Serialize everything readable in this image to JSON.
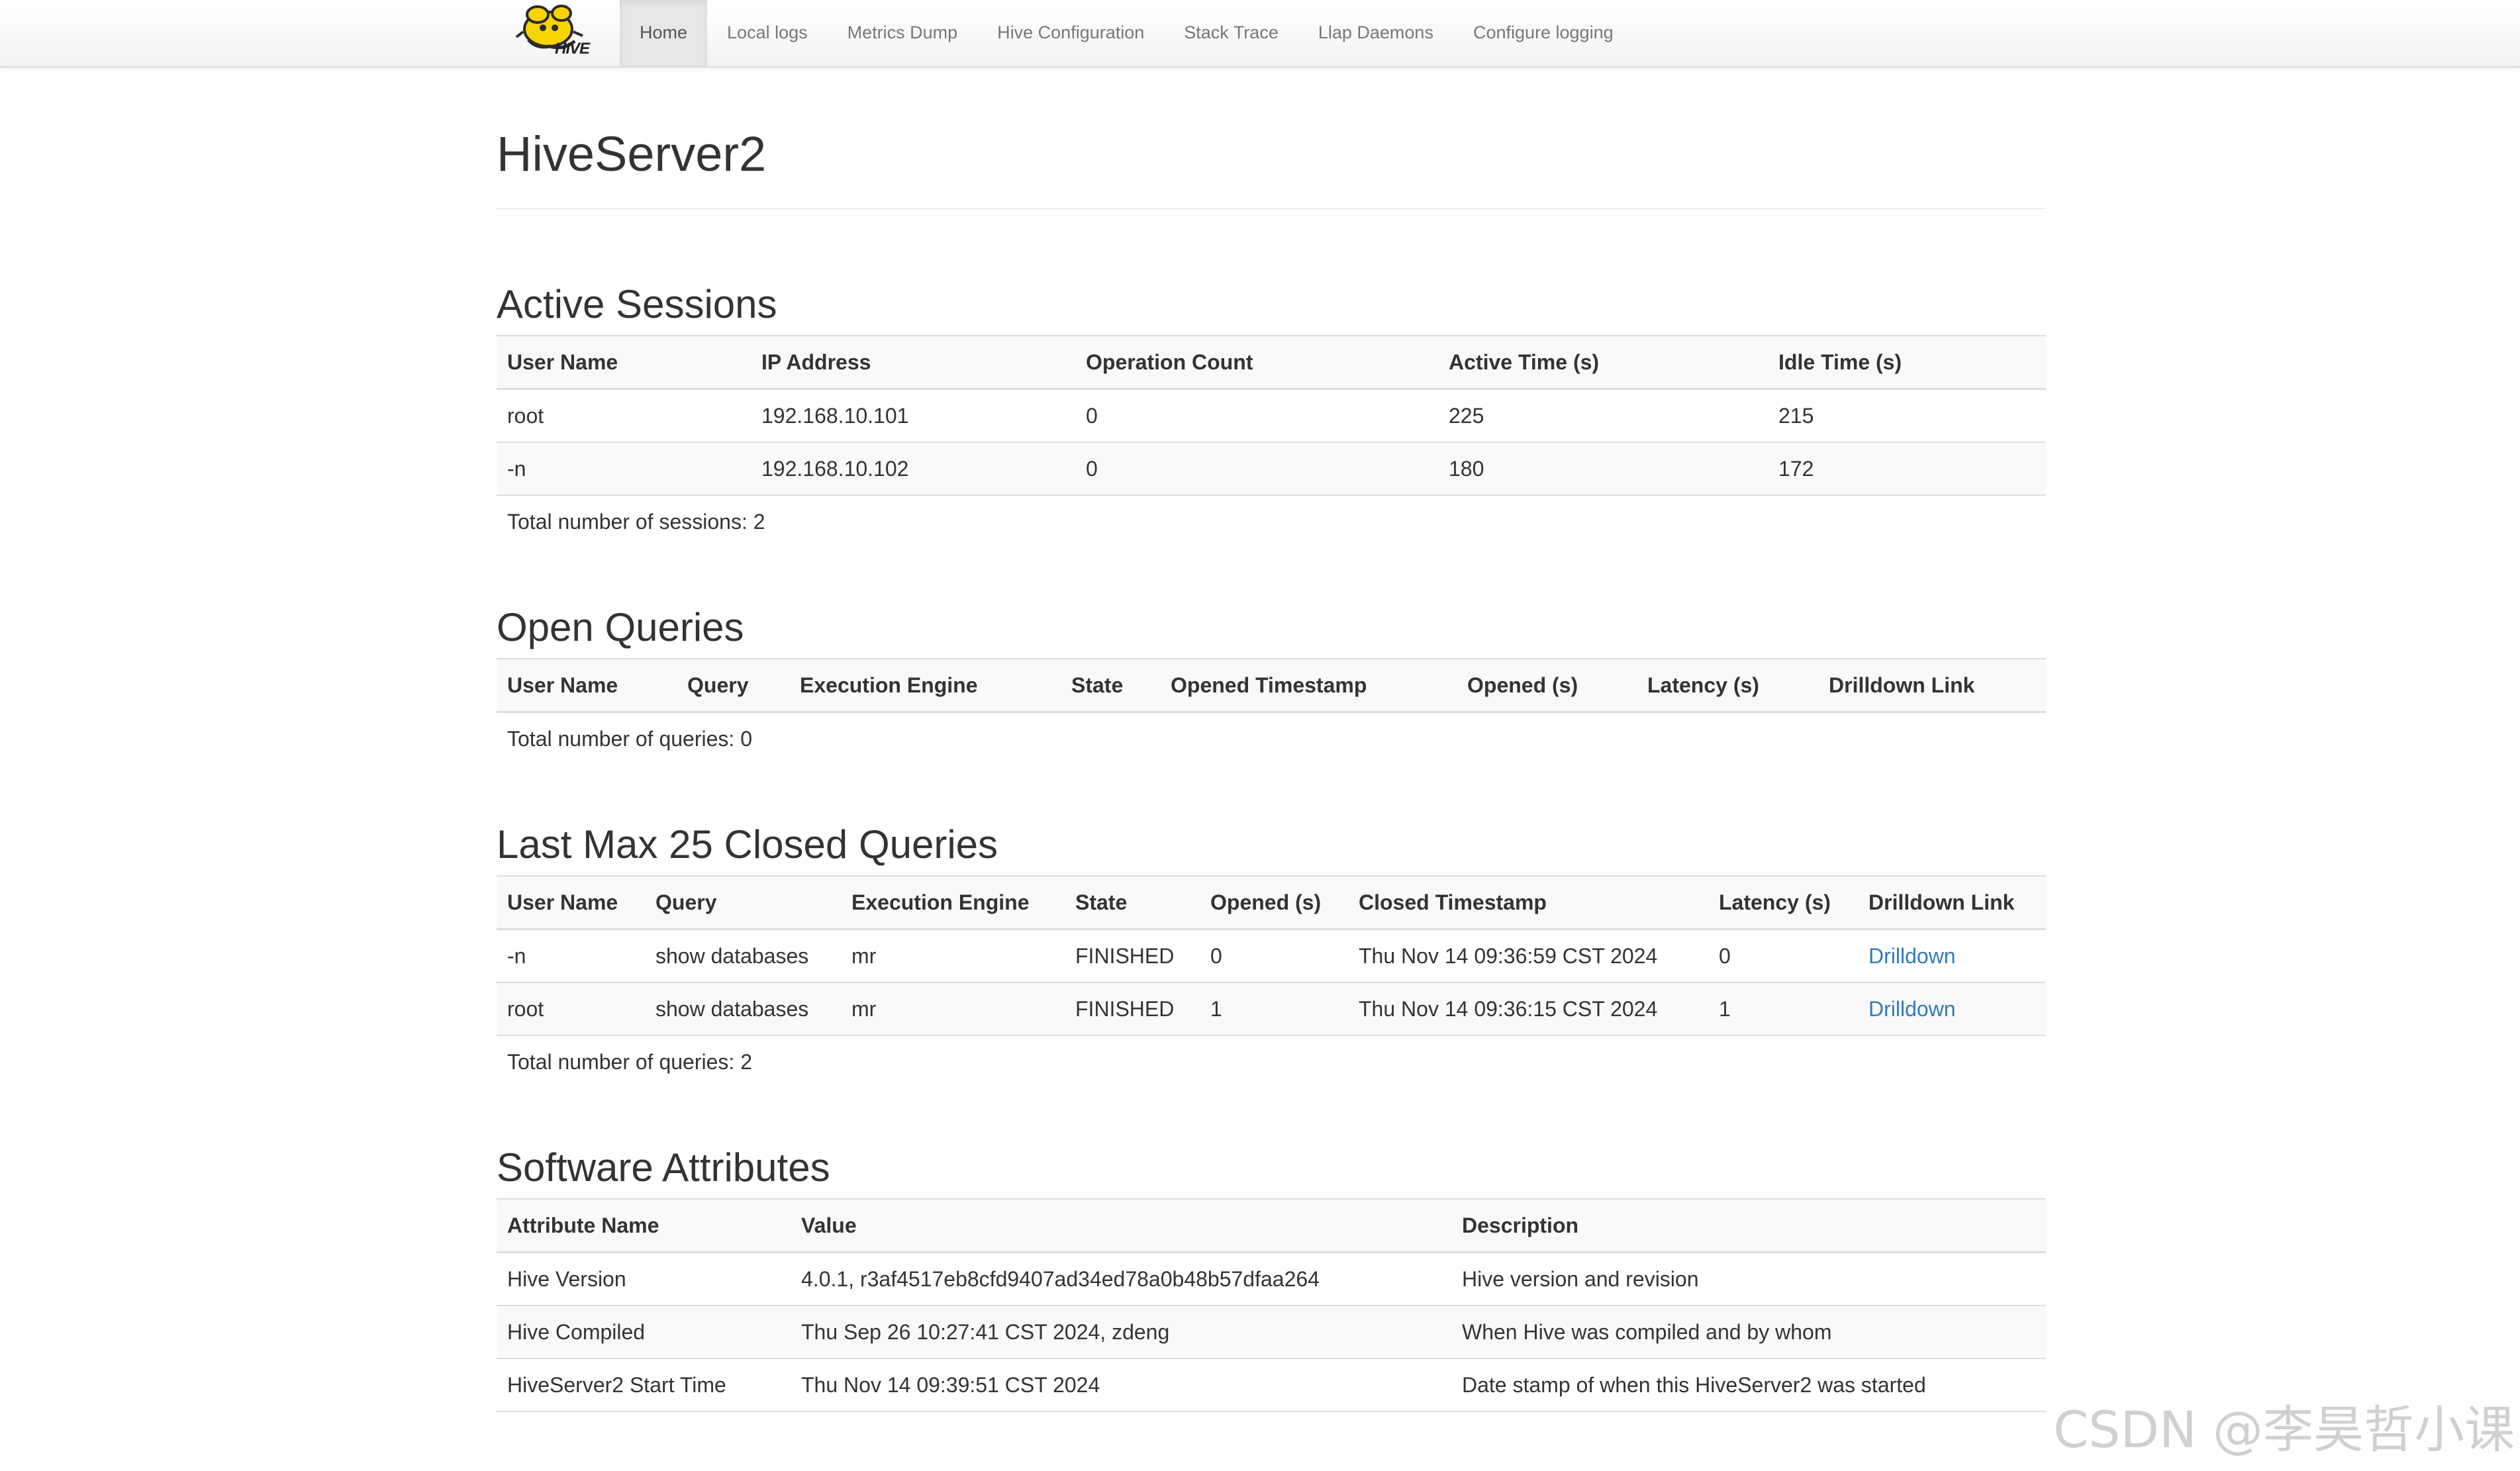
{
  "nav": {
    "logo_text": "HIVE",
    "items": [
      {
        "label": "Home",
        "active": true
      },
      {
        "label": "Local logs"
      },
      {
        "label": "Metrics Dump"
      },
      {
        "label": "Hive Configuration"
      },
      {
        "label": "Stack Trace"
      },
      {
        "label": "Llap Daemons"
      },
      {
        "label": "Configure logging"
      }
    ]
  },
  "page_title": "HiveServer2",
  "active_sessions": {
    "title": "Active Sessions",
    "headers": [
      "User Name",
      "IP Address",
      "Operation Count",
      "Active Time (s)",
      "Idle Time (s)"
    ],
    "rows": [
      [
        "root",
        "192.168.10.101",
        "0",
        "225",
        "215"
      ],
      [
        "-n",
        "192.168.10.102",
        "0",
        "180",
        "172"
      ]
    ],
    "total": "Total number of sessions: 2"
  },
  "open_queries": {
    "title": "Open Queries",
    "headers": [
      "User Name",
      "Query",
      "Execution Engine",
      "State",
      "Opened Timestamp",
      "Opened (s)",
      "Latency (s)",
      "Drilldown Link"
    ],
    "total": "Total number of queries: 0"
  },
  "closed_queries": {
    "title": "Last Max 25 Closed Queries",
    "headers": [
      "User Name",
      "Query",
      "Execution Engine",
      "State",
      "Opened (s)",
      "Closed Timestamp",
      "Latency (s)",
      "Drilldown Link"
    ],
    "rows": [
      [
        "-n",
        "show databases",
        "mr",
        "FINISHED",
        "0",
        "Thu Nov 14 09:36:59 CST 2024",
        "0",
        "Drilldown"
      ],
      [
        "root",
        "show databases",
        "mr",
        "FINISHED",
        "1",
        "Thu Nov 14 09:36:15 CST 2024",
        "1",
        "Drilldown"
      ]
    ],
    "total": "Total number of queries: 2"
  },
  "software_attributes": {
    "title": "Software Attributes",
    "headers": [
      "Attribute Name",
      "Value",
      "Description"
    ],
    "rows": [
      [
        "Hive Version",
        "4.0.1, r3af4517eb8cfd9407ad34ed78a0b48b57dfaa264",
        "Hive version and revision"
      ],
      [
        "Hive Compiled",
        "Thu Sep 26 10:27:41 CST 2024, zdeng",
        "When Hive was compiled and by whom"
      ],
      [
        "HiveServer2 Start Time",
        "Thu Nov 14 09:39:51 CST 2024",
        "Date stamp of when this HiveServer2 was started"
      ]
    ]
  },
  "watermark": "CSDN @李昊哲小课",
  "colors": {
    "link": "#337ab7",
    "logo_yellow": "#f5d400"
  }
}
